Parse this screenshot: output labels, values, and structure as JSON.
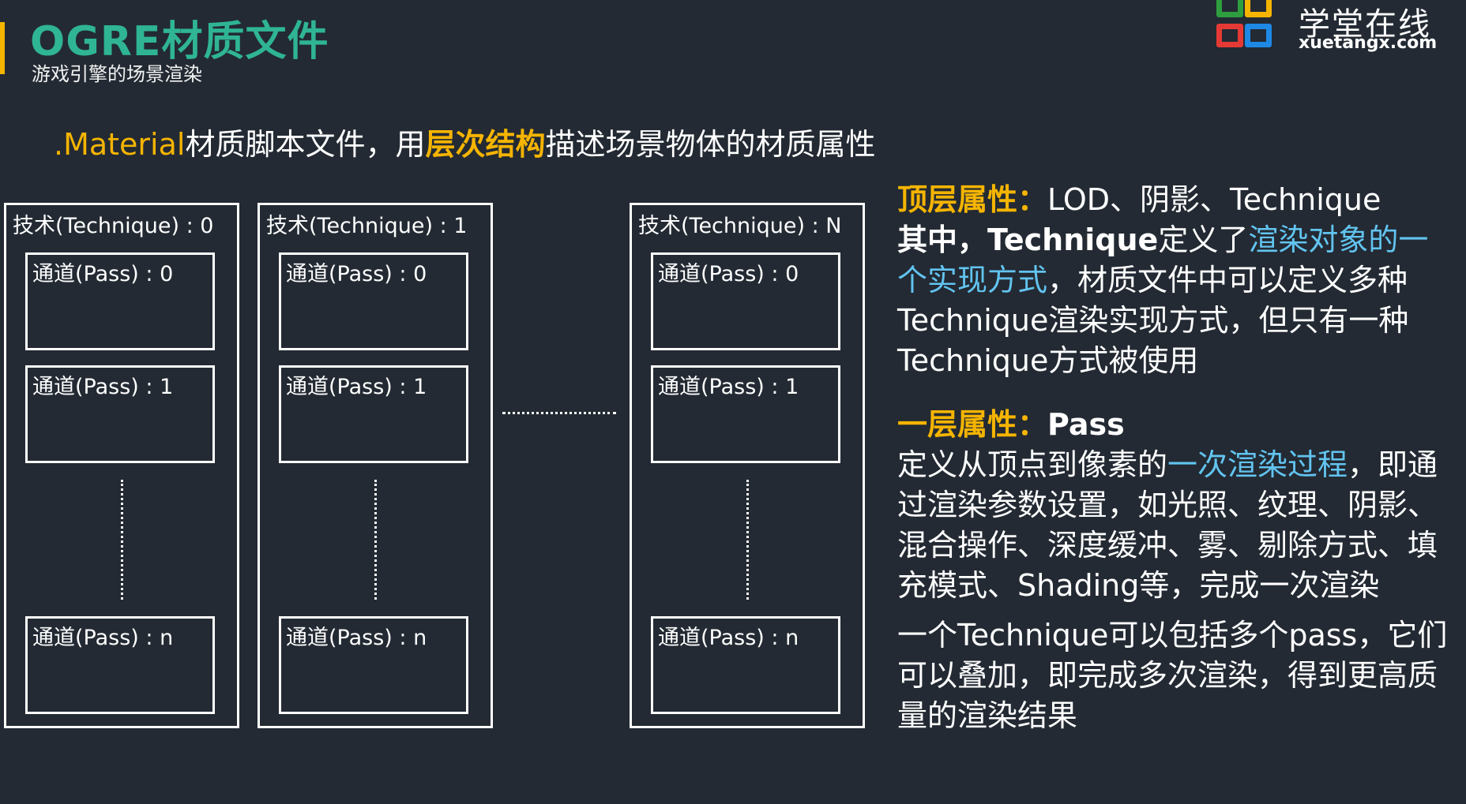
{
  "header": {
    "title": "OGRE材质文件",
    "subtitle": "游戏引擎的场景渲染",
    "accent_color": "#f5b400",
    "title_color": "#2fb594"
  },
  "logo": {
    "brand_cn": "学堂在线",
    "brand_url": "xuetangx.com",
    "colors": [
      "#2e9e3e",
      "#f5b400",
      "#e53935",
      "#1e88e5"
    ]
  },
  "intro": {
    "part1": ".Material",
    "part2": "材质脚本文件，用",
    "part3": "层次结构",
    "part4": "描述场景物体的材质属性"
  },
  "diagram": {
    "techniques": [
      {
        "label": "技术(Technique) : 0",
        "passes": [
          "通道(Pass) : 0",
          "通道(Pass) : 1",
          "通道(Pass) : n"
        ]
      },
      {
        "label": "技术(Technique) : 1",
        "passes": [
          "通道(Pass) : 0",
          "通道(Pass) : 1",
          "通道(Pass) : n"
        ]
      },
      {
        "label": "技术(Technique) : N",
        "passes": [
          "通道(Pass) : 0",
          "通道(Pass) : 1",
          "通道(Pass) : n"
        ]
      }
    ]
  },
  "panel": {
    "top_heading": "顶层属性：",
    "top_items": "LOD、阴影、Technique",
    "top_bold": "其中，Technique",
    "top_text1": "定义了",
    "top_blue": "渲染对象的一个实现方式",
    "top_text2": "，材质文件中可以定义多种Technique渲染实现方式，但只有一种Technique方式被使用",
    "layer_heading": "一层属性：",
    "layer_item": "Pass",
    "layer_text1": "定义从顶点到像素的",
    "layer_blue": "一次渲染过程",
    "layer_text2": "，即通过渲染参数设置，如光照、纹理、阴影、混合操作、深度缓冲、雾、剔除方式、填充模式、Shading等，完成一次渲染",
    "closing": "一个Technique可以包括多个pass，它们可以叠加，即完成多次渲染，得到更高质量的渲染结果",
    "blue_color": "#62c4f0"
  }
}
